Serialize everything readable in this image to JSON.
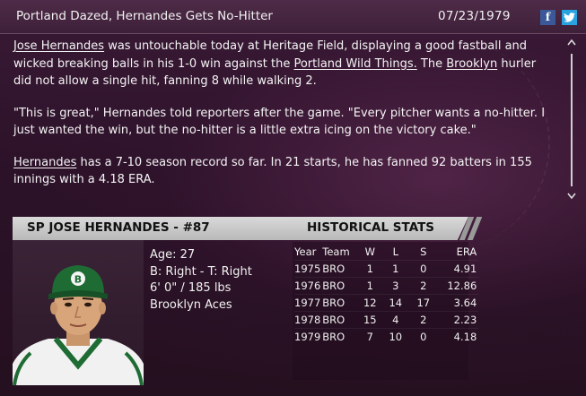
{
  "header": {
    "title": "Portland Dazed, Hernandes Gets No-Hitter",
    "date": "07/23/1979",
    "facebook_icon": "facebook-icon",
    "twitter_icon": "twitter-icon"
  },
  "article": {
    "p1": {
      "link_pitcher": "Jose Hernandes",
      "text_a": " was untouchable today at Heritage Field, displaying a good fastball and wicked breaking balls in his 1-0 win against the ",
      "link_opponent": "Portland Wild Things.",
      "text_b": " The ",
      "link_team": "Brooklyn",
      "text_c": " hurler did not allow a single hit, fanning 8 while walking 2."
    },
    "p2": "\"This is great,\" Hernandes told reporters after the game. \"Every pitcher wants a no-hitter. I just wanted the win, but the no-hitter is a little extra icing on the victory cake.\"",
    "p3": {
      "link_pitcher": "Hernandes",
      "text": " has a 7-10 season record so far. In 21 starts, he has fanned 92 batters in 155 innings with a 4.18 ERA."
    },
    "scroll_up": "^",
    "scroll_down": "v"
  },
  "player": {
    "header": "SP JOSE HERNANDES - #87",
    "cap_letter": "B",
    "age": "Age: 27",
    "bats_throws": "B: Right - T: Right",
    "height_weight": "6' 0\" / 185 lbs",
    "team": "Brooklyn Aces"
  },
  "stats": {
    "header": "HISTORICAL STATS",
    "columns": [
      "Year",
      "Team",
      "W",
      "L",
      "S",
      "ERA"
    ],
    "rows": [
      [
        "1975",
        "BRO",
        "1",
        "1",
        "0",
        "4.91"
      ],
      [
        "1976",
        "BRO",
        "1",
        "3",
        "2",
        "12.86"
      ],
      [
        "1977",
        "BRO",
        "12",
        "14",
        "17",
        "3.64"
      ],
      [
        "1978",
        "BRO",
        "15",
        "4",
        "2",
        "2.23"
      ],
      [
        "1979",
        "BRO",
        "7",
        "10",
        "0",
        "4.18"
      ]
    ]
  },
  "colors": {
    "background": "#2c1229",
    "header_bg": "#4e2b48",
    "band": "#cfcfcf",
    "facebook": "#3b5998",
    "twitter": "#29a3e0",
    "cap_green": "#1f6b34"
  }
}
